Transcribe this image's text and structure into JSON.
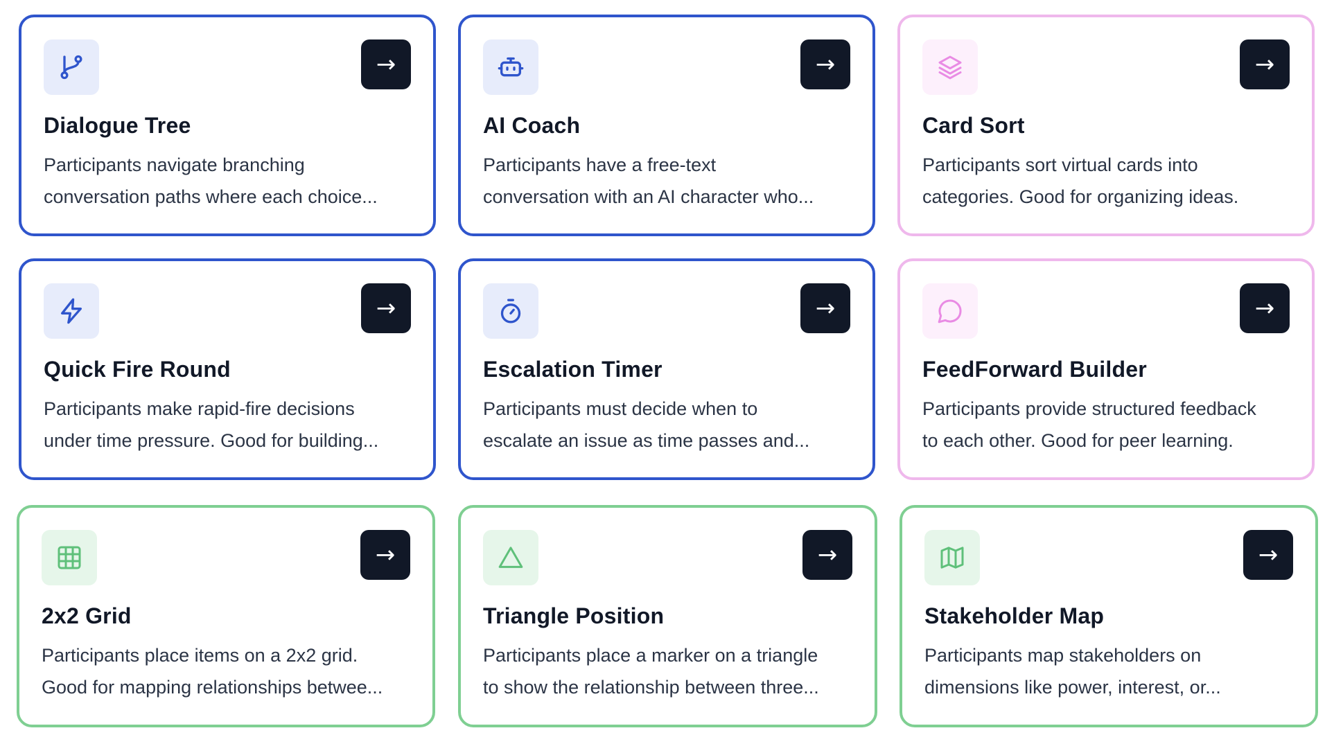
{
  "arrow_glyph": "→",
  "colors": {
    "blue_border": "#2f55cc",
    "pink_border": "#efb8ec",
    "green_border": "#7fcf92",
    "button_bg": "#111827"
  },
  "cards": [
    {
      "title": "Dialogue Tree",
      "desc_line1": "Participants navigate branching",
      "desc_line2": "conversation paths where each choice...",
      "icon": "git-branch-icon",
      "theme": "blue"
    },
    {
      "title": "AI Coach",
      "desc_line1": "Participants have a free-text",
      "desc_line2": "conversation with an AI character who...",
      "icon": "bot-icon",
      "theme": "blue"
    },
    {
      "title": "Card Sort",
      "desc_line1": "Participants sort virtual cards into",
      "desc_line2": "categories. Good for organizing ideas.",
      "icon": "layers-icon",
      "theme": "pink"
    },
    {
      "title": "Quick Fire Round",
      "desc_line1": "Participants make rapid-fire decisions",
      "desc_line2": "under time pressure. Good for building...",
      "icon": "lightning-icon",
      "theme": "blue"
    },
    {
      "title": "Escalation Timer",
      "desc_line1": "Participants must decide when to",
      "desc_line2": "escalate an issue as time passes and...",
      "icon": "stopwatch-icon",
      "theme": "blue"
    },
    {
      "title": "FeedForward Builder",
      "desc_line1": "Participants provide structured feedback",
      "desc_line2": "to each other. Good for peer learning.",
      "icon": "chat-bubble-icon",
      "theme": "pink"
    },
    {
      "title": "2x2 Grid",
      "desc_line1": "Participants place items on a 2x2 grid.",
      "desc_line2": "Good for mapping relationships betwee...",
      "icon": "grid-icon",
      "theme": "green"
    },
    {
      "title": "Triangle Position",
      "desc_line1": "Participants place a marker on a triangle",
      "desc_line2": "to show the relationship between three...",
      "icon": "triangle-icon",
      "theme": "green"
    },
    {
      "title": "Stakeholder Map",
      "desc_line1": "Participants map stakeholders on",
      "desc_line2": "dimensions like power, interest, or...",
      "icon": "map-icon",
      "theme": "green"
    }
  ]
}
